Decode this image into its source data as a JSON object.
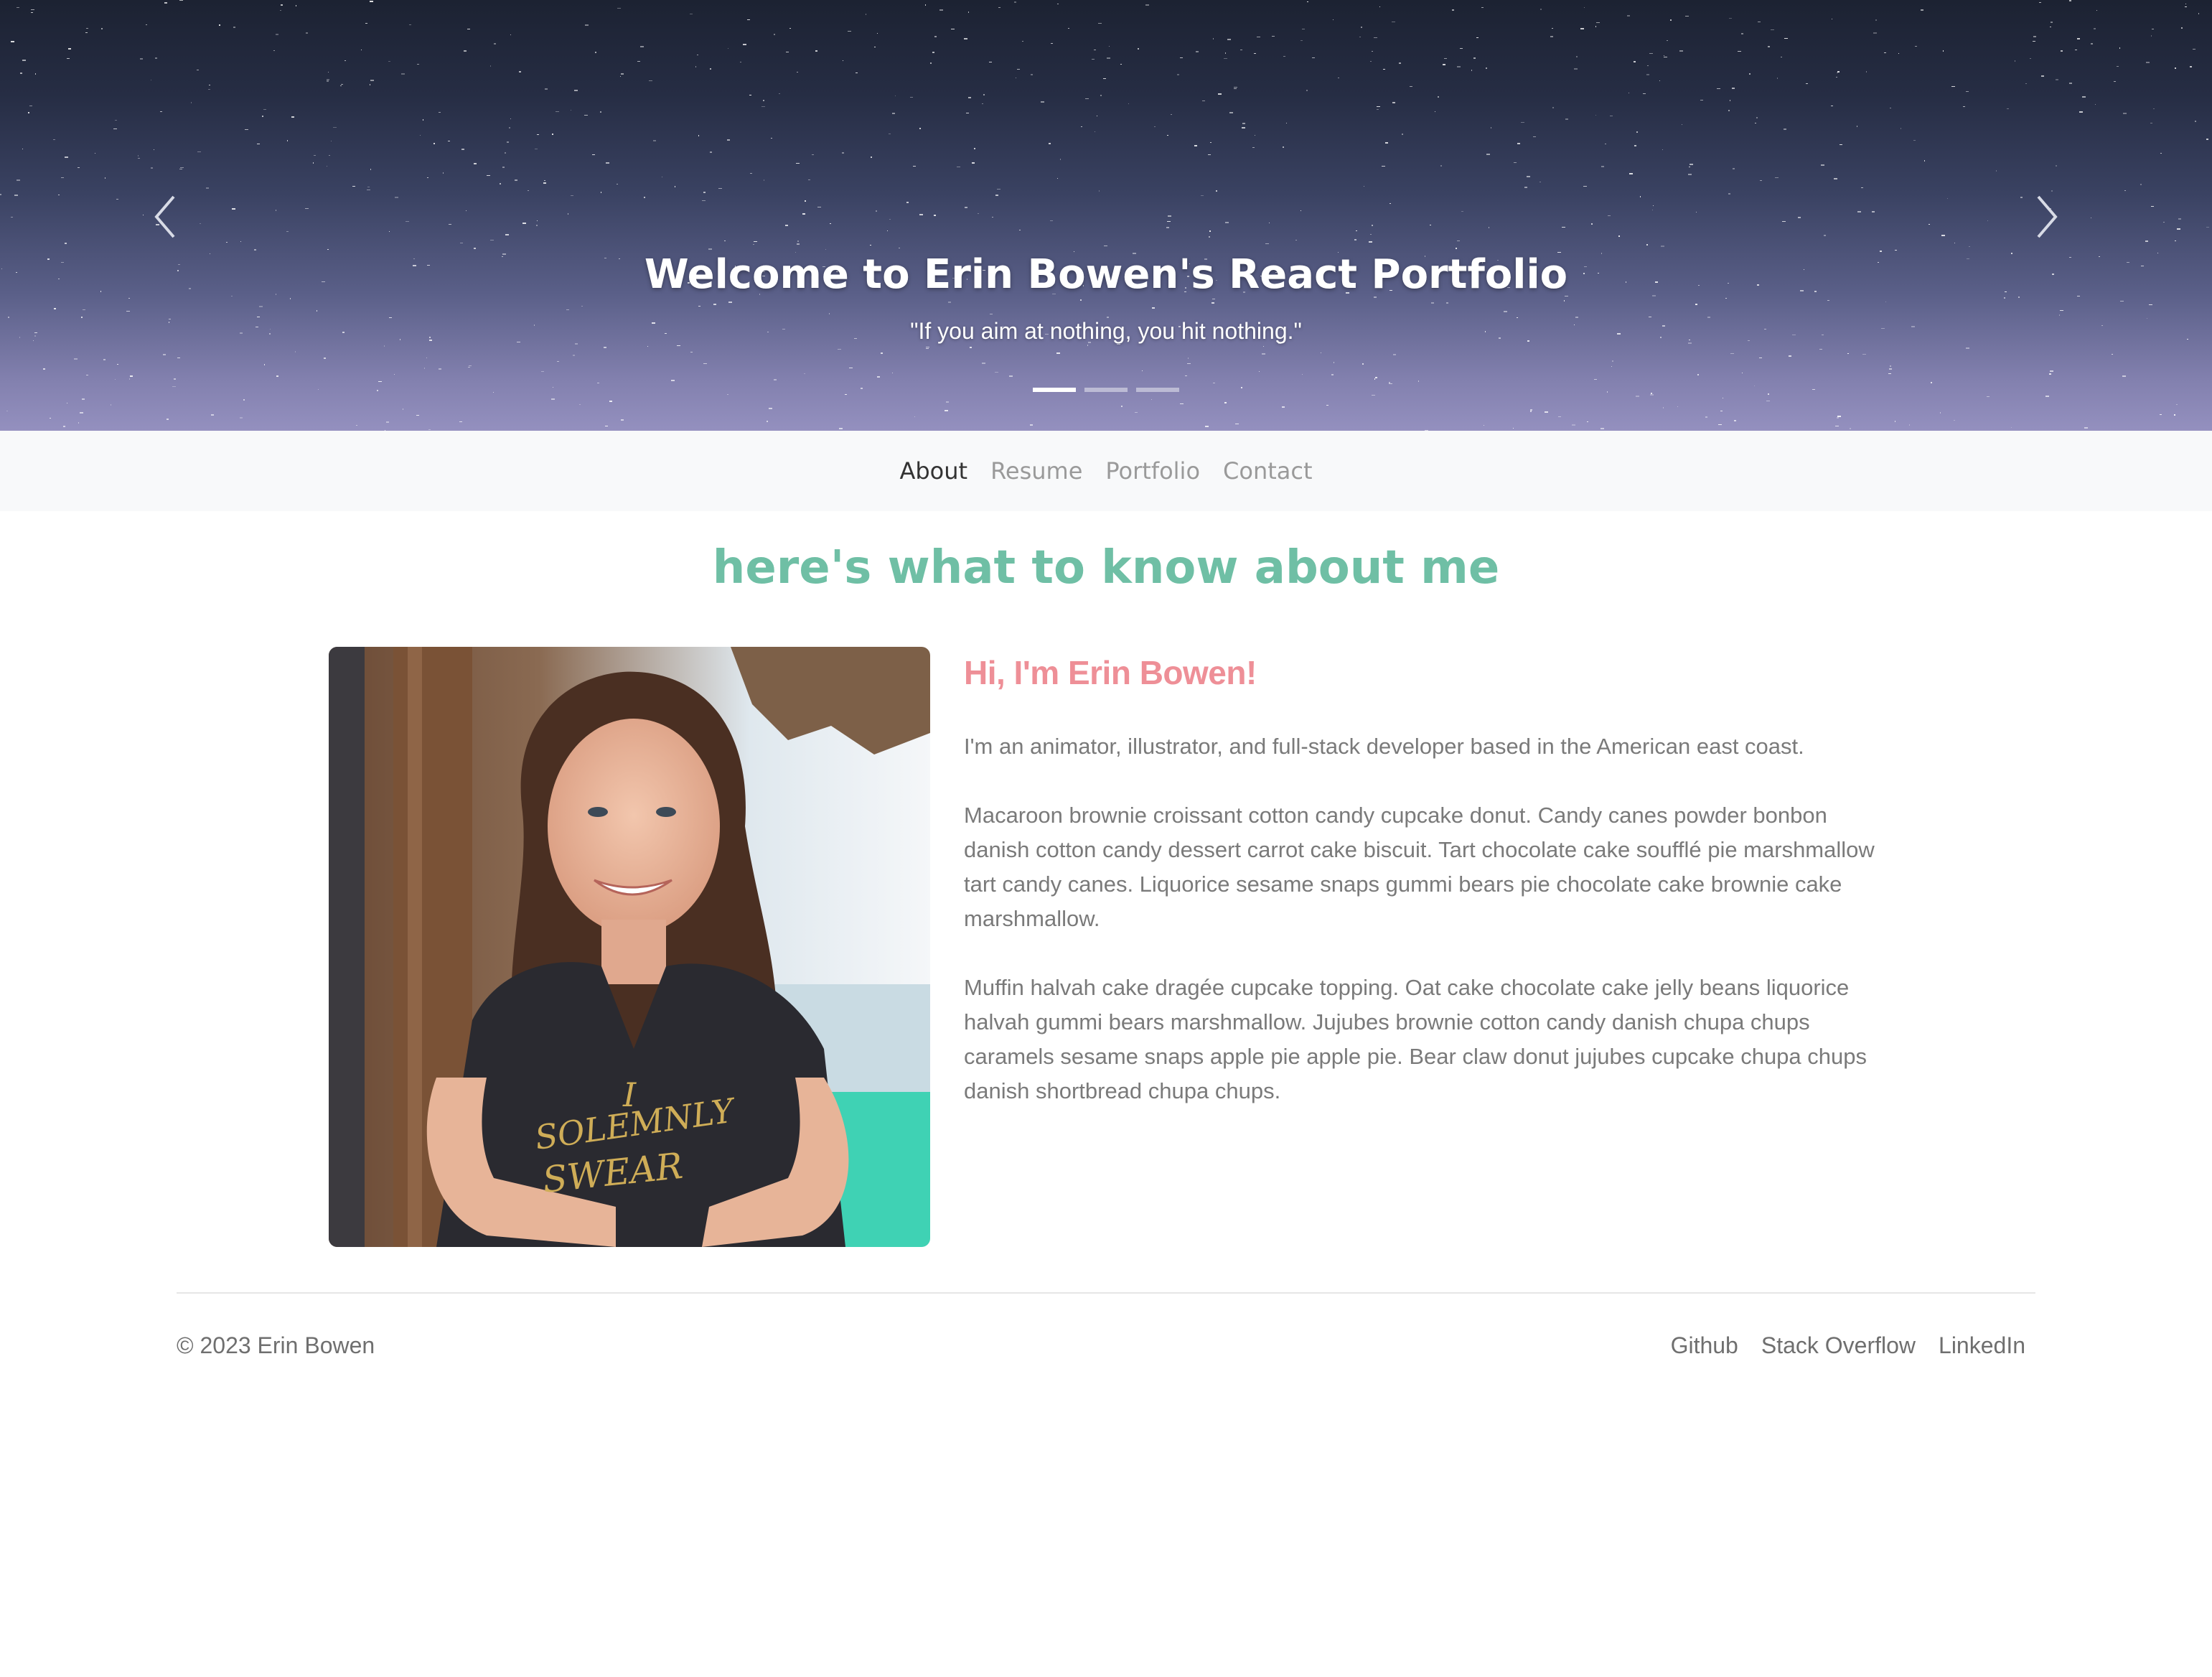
{
  "hero": {
    "title": "Welcome to Erin Bowen's React Portfolio",
    "quote": "\"If you aim at nothing, you hit nothing.\"",
    "prev_icon": "chevron-left-icon",
    "next_icon": "chevron-right-icon",
    "slide_count": 3,
    "active_slide": 1
  },
  "nav": {
    "items": [
      {
        "label": "About",
        "active": true
      },
      {
        "label": "Resume",
        "active": false
      },
      {
        "label": "Portfolio",
        "active": false
      },
      {
        "label": "Contact",
        "active": false
      }
    ]
  },
  "about": {
    "heading": "here's what to know about me",
    "greeting": "Hi, I'm Erin Bowen!",
    "paragraphs": [
      "I'm an animator, illustrator, and full-stack developer based in the American east coast.",
      "Macaroon brownie croissant cotton candy cupcake donut. Candy canes powder bonbon danish cotton candy dessert carrot cake biscuit. Tart chocolate cake soufflé pie marshmallow tart candy canes. Liquorice sesame snaps gummi bears pie chocolate cake brownie cake marshmallow.",
      "Muffin halvah cake dragée cupcake topping. Oat cake chocolate cake jelly beans liquorice halvah gummi bears marshmallow. Jujubes brownie cotton candy danish chupa chups caramels sesame snaps apple pie apple pie. Bear claw donut jujubes cupcake chupa chups danish shortbread chupa chups."
    ],
    "portrait_shirt_text": "I SOLEMNLY SWEAR"
  },
  "footer": {
    "copyright": "© 2023 Erin Bowen",
    "links": [
      "Github",
      "Stack Overflow",
      "LinkedIn"
    ]
  },
  "colors": {
    "heading": "#6fbfa5",
    "greeting": "#ee8f97",
    "nav_bg": "#f8f9fa",
    "body_text": "#7a7a7a"
  }
}
